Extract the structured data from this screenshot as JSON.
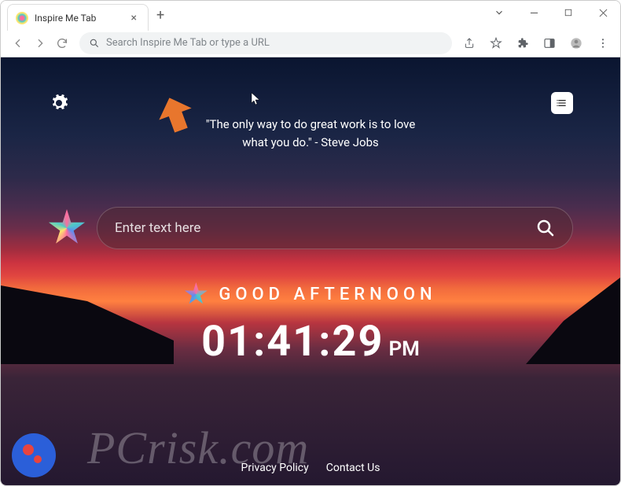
{
  "tab": {
    "title": "Inspire Me Tab"
  },
  "omnibox": {
    "placeholder": "Search Inspire Me Tab or type a URL"
  },
  "quote": {
    "text": "\"The only way to do great work is to love what you do.\" - Steve Jobs"
  },
  "search": {
    "placeholder": "Enter text here"
  },
  "greeting": {
    "text": "GOOD AFTERNOON"
  },
  "clock": {
    "time": "01:41:29",
    "ampm": "PM"
  },
  "footer": {
    "privacy": "Privacy Policy",
    "contact": "Contact Us"
  },
  "watermark": {
    "text": "PCrisk.com"
  }
}
